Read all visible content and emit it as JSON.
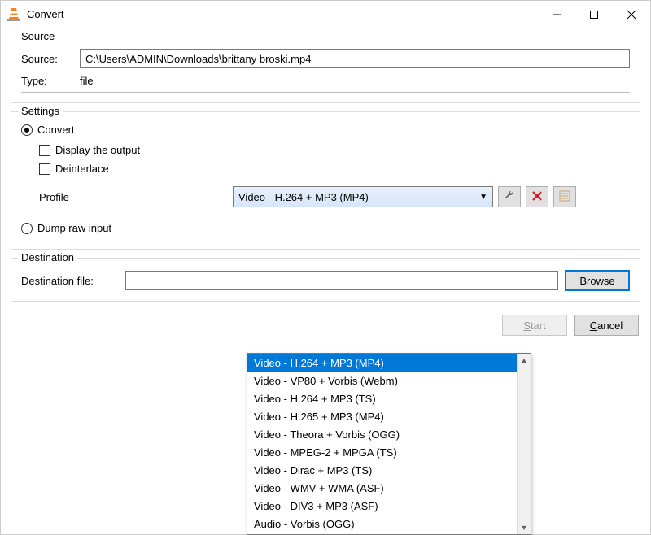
{
  "window": {
    "title": "Convert"
  },
  "source_group": {
    "legend": "Source",
    "source_label": "Source:",
    "source_value": "C:\\Users\\ADMIN\\Downloads\\brittany broski.mp4",
    "type_label": "Type:",
    "type_value": "file"
  },
  "settings_group": {
    "legend": "Settings",
    "convert_label": "Convert",
    "display_output_label": "Display the output",
    "deinterlace_label": "Deinterlace",
    "profile_label": "Profile",
    "dump_raw_label": "Dump raw input"
  },
  "profile_combo": {
    "selected": "Video - H.264 + MP3 (MP4)",
    "options": [
      "Video - H.264 + MP3 (MP4)",
      "Video - VP80 + Vorbis (Webm)",
      "Video - H.264 + MP3 (TS)",
      "Video - H.265 + MP3 (MP4)",
      "Video - Theora + Vorbis (OGG)",
      "Video - MPEG-2 + MPGA (TS)",
      "Video - Dirac + MP3 (TS)",
      "Video - WMV + WMA (ASF)",
      "Video - DIV3 + MP3 (ASF)",
      "Audio - Vorbis (OGG)"
    ],
    "highlight_index": 0
  },
  "profile_buttons": {
    "edit_icon": "wrench-icon",
    "delete_icon": "x-icon",
    "new_icon": "list-new-icon"
  },
  "destination_group": {
    "legend": "Destination",
    "dest_file_label": "Destination file:",
    "dest_file_value": "",
    "browse_label": "Browse"
  },
  "footer": {
    "start_label": "Start",
    "cancel_label": "Cancel"
  },
  "colors": {
    "accent": "#0078d7",
    "delete_red": "#d21c1c"
  }
}
